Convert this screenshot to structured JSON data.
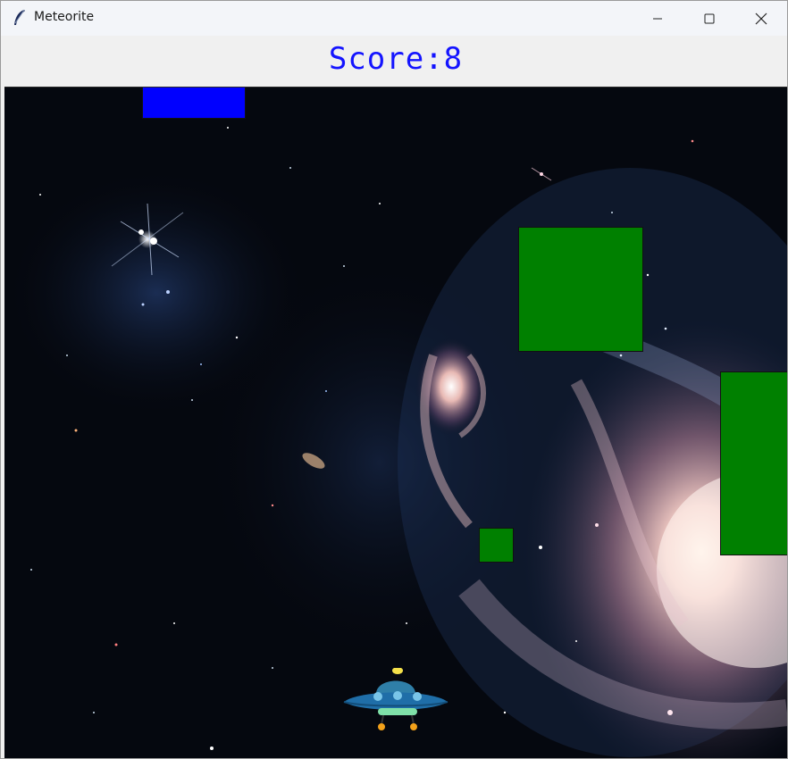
{
  "window": {
    "title": "Meteorite"
  },
  "controls": {
    "minimize": "minimize",
    "maximize": "maximize",
    "close": "close"
  },
  "score": {
    "text": "Score:8",
    "value": 8
  },
  "colors": {
    "score": "#1414ff",
    "falling_block_blue": "#0000ff",
    "falling_block_green": "#008000"
  }
}
